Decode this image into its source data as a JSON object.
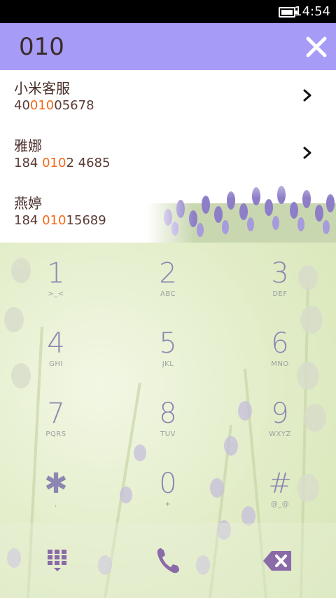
{
  "status_bar": {
    "time": "14:54"
  },
  "dialer": {
    "number": "010"
  },
  "results": [
    {
      "name": "小米客服",
      "number_pre": "40",
      "number_hl": "010",
      "number_post": "05678"
    },
    {
      "name": "雅娜",
      "number_pre": "184 ",
      "number_hl": "010",
      "number_post": "2 4685"
    },
    {
      "name": "燕婷",
      "number_pre": "184 ",
      "number_hl": "010",
      "number_post": "15689"
    }
  ],
  "keys": [
    {
      "digit": "1",
      "letters": ">_<"
    },
    {
      "digit": "2",
      "letters": "ABC"
    },
    {
      "digit": "3",
      "letters": "DEF"
    },
    {
      "digit": "4",
      "letters": "GHI"
    },
    {
      "digit": "5",
      "letters": "JKL"
    },
    {
      "digit": "6",
      "letters": "MNO"
    },
    {
      "digit": "7",
      "letters": "PQRS"
    },
    {
      "digit": "8",
      "letters": "TUV"
    },
    {
      "digit": "9",
      "letters": "WXYZ"
    },
    {
      "digit": "✱",
      "letters": ","
    },
    {
      "digit": "0",
      "letters": "+"
    },
    {
      "digit": "#",
      "letters": "@_@"
    }
  ],
  "colors": {
    "header": "#a69bf6",
    "highlight": "#f06a1a",
    "icon": "#8a6aa8"
  },
  "icons": {
    "close": "close-icon",
    "keypad": "keypad-grid-icon",
    "call": "phone-icon",
    "delete": "backspace-icon"
  }
}
